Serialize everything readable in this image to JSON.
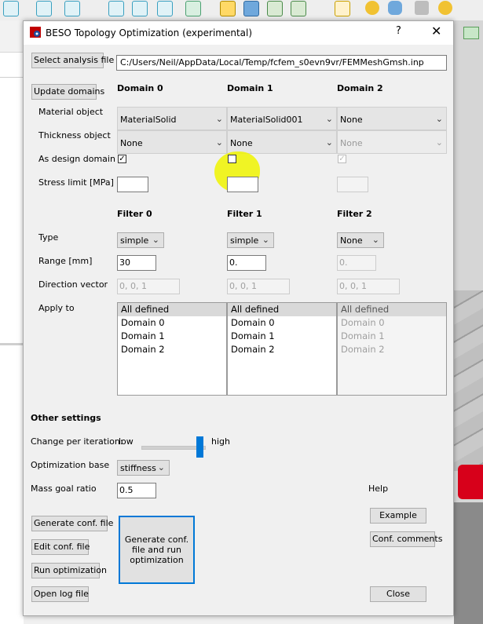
{
  "dialog": {
    "title": "BESO Topology Optimization (experimental)",
    "help_button": "?",
    "close_x": "✕"
  },
  "analysis": {
    "select_button": "Select analysis file",
    "file_path": "C:/Users/Neil/AppData/Local/Temp/fcfem_s0evn9vr/FEMMeshGmsh.inp",
    "update_button": "Update domains"
  },
  "domains": {
    "headers": [
      "Domain 0",
      "Domain 1",
      "Domain 2"
    ],
    "labels": {
      "material": "Material object",
      "thickness": "Thickness object",
      "design": "As design domain",
      "stress": "Stress limit [MPa]"
    },
    "material_values": [
      "MaterialSolid",
      "MaterialSolid001",
      "None"
    ],
    "thickness_values": [
      "None",
      "None",
      "None"
    ],
    "design_checked": [
      "✓",
      "",
      "✓"
    ]
  },
  "filters": {
    "headers": [
      "Filter 0",
      "Filter 1",
      "Filter 2"
    ],
    "labels": {
      "type": "Type",
      "range": "Range [mm]",
      "direction": "Direction vector",
      "apply": "Apply to"
    },
    "type_values": [
      "simple",
      "simple",
      "None"
    ],
    "range_values": [
      "30",
      "0.",
      "0."
    ],
    "direction_placeholder": "0, 0, 1",
    "apply_items": [
      "All defined",
      "Domain 0",
      "Domain 1",
      "Domain 2"
    ]
  },
  "other": {
    "heading": "Other settings",
    "change_label": "Change per iteration:",
    "low": "low",
    "high": "high",
    "slider_fraction": 1.0,
    "opt_base_label": "Optimization base",
    "opt_base_value": "stiffness",
    "mass_label": "Mass goal ratio",
    "mass_value": "0.5"
  },
  "buttons": {
    "generate_conf": "Generate conf. file",
    "edit_conf": "Edit conf. file",
    "run_opt": "Run optimization",
    "open_log": "Open log file",
    "generate_run": "Generate conf. file and run optimization",
    "help_label": "Help",
    "example": "Example",
    "conf_comments": "Conf. comments",
    "close": "Close"
  },
  "colors": {
    "accent": "#0078d7",
    "highlight": "#f0f400"
  }
}
